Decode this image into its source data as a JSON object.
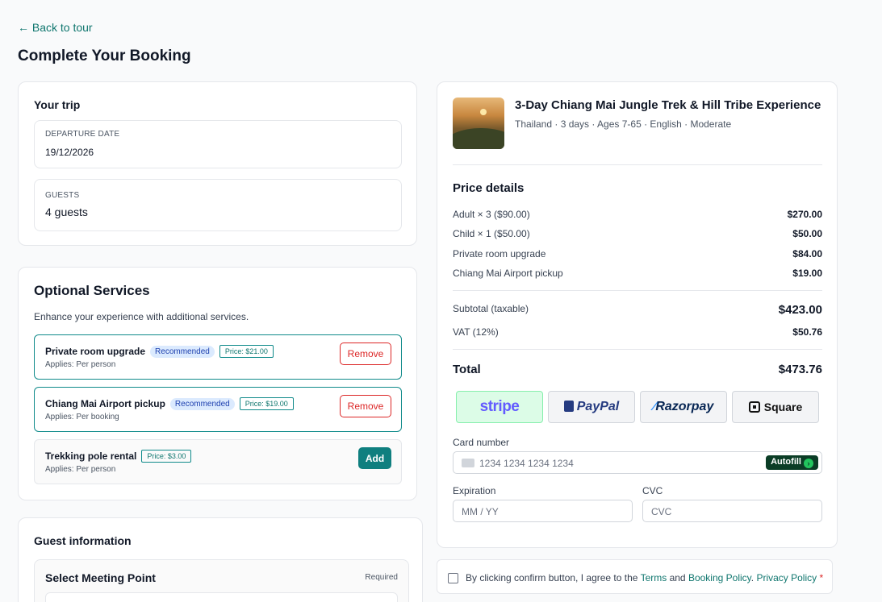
{
  "nav": {
    "back_label": "← Back to tour"
  },
  "page": {
    "title": "Complete Your Booking"
  },
  "trip": {
    "heading": "Your trip",
    "departure_label": "DEPARTURE DATE",
    "departure_value": "19/12/2026",
    "guests_label": "GUESTS",
    "guests_value": "4 guests"
  },
  "services": {
    "heading": "Optional Services",
    "subtitle": "Enhance your experience with additional services.",
    "items": [
      {
        "name": "Private room upgrade",
        "badge": "Recommended",
        "price": "Price: $21.00",
        "applies": "Applies: Per person",
        "action": "Remove"
      },
      {
        "name": "Chiang Mai Airport pickup",
        "badge": "Recommended",
        "price": "Price: $19.00",
        "applies": "Applies: Per booking",
        "action": "Remove"
      },
      {
        "name": "Trekking pole rental",
        "badge": "",
        "price": "Price: $3.00",
        "applies": "Applies: Per person",
        "action": "Add"
      }
    ]
  },
  "guest": {
    "heading": "Guest information",
    "meeting_heading": "Select Meeting Point",
    "required_label": "Required"
  },
  "tour": {
    "title": "3-Day Chiang Mai Jungle Trek & Hill Tribe Experience",
    "meta": "Thailand · 3 days · Ages 7-65 · English · Moderate"
  },
  "price": {
    "heading": "Price details",
    "lines": [
      {
        "label": "Adult × 3 ($90.00)",
        "value": "$270.00"
      },
      {
        "label": "Child × 1 ($50.00)",
        "value": "$50.00"
      },
      {
        "label": "Private room upgrade",
        "value": "$84.00"
      },
      {
        "label": "Chiang Mai Airport pickup",
        "value": "$19.00"
      }
    ],
    "subtotal_label": "Subtotal (taxable)",
    "subtotal_value": "$423.00",
    "vat_label": "VAT (12%)",
    "vat_value": "$50.76",
    "total_label": "Total",
    "total_value": "$473.76"
  },
  "payment": {
    "methods": [
      "stripe",
      "PayPal",
      "Razorpay",
      "Square"
    ],
    "selected": "stripe",
    "card_label": "Card number",
    "card_placeholder": "1234 1234 1234 1234",
    "autofill_label": "Autofill",
    "exp_label": "Expiration",
    "exp_placeholder": "MM / YY",
    "cvc_label": "CVC",
    "cvc_placeholder": "CVC"
  },
  "agreement": {
    "prefix": "By clicking confirm button, I agree to the ",
    "terms": "Terms",
    "and": " and ",
    "booking_policy": "Booking Policy",
    "dot": ". ",
    "privacy_policy": "Privacy Policy",
    "required_mark": "*"
  },
  "colors": {
    "accent": "#0f766e",
    "danger": "#dc2626",
    "stripe": "#635bff",
    "paypal_dark": "#253b80",
    "paypal_light": "#179bd7",
    "razorpay": "#072654"
  }
}
